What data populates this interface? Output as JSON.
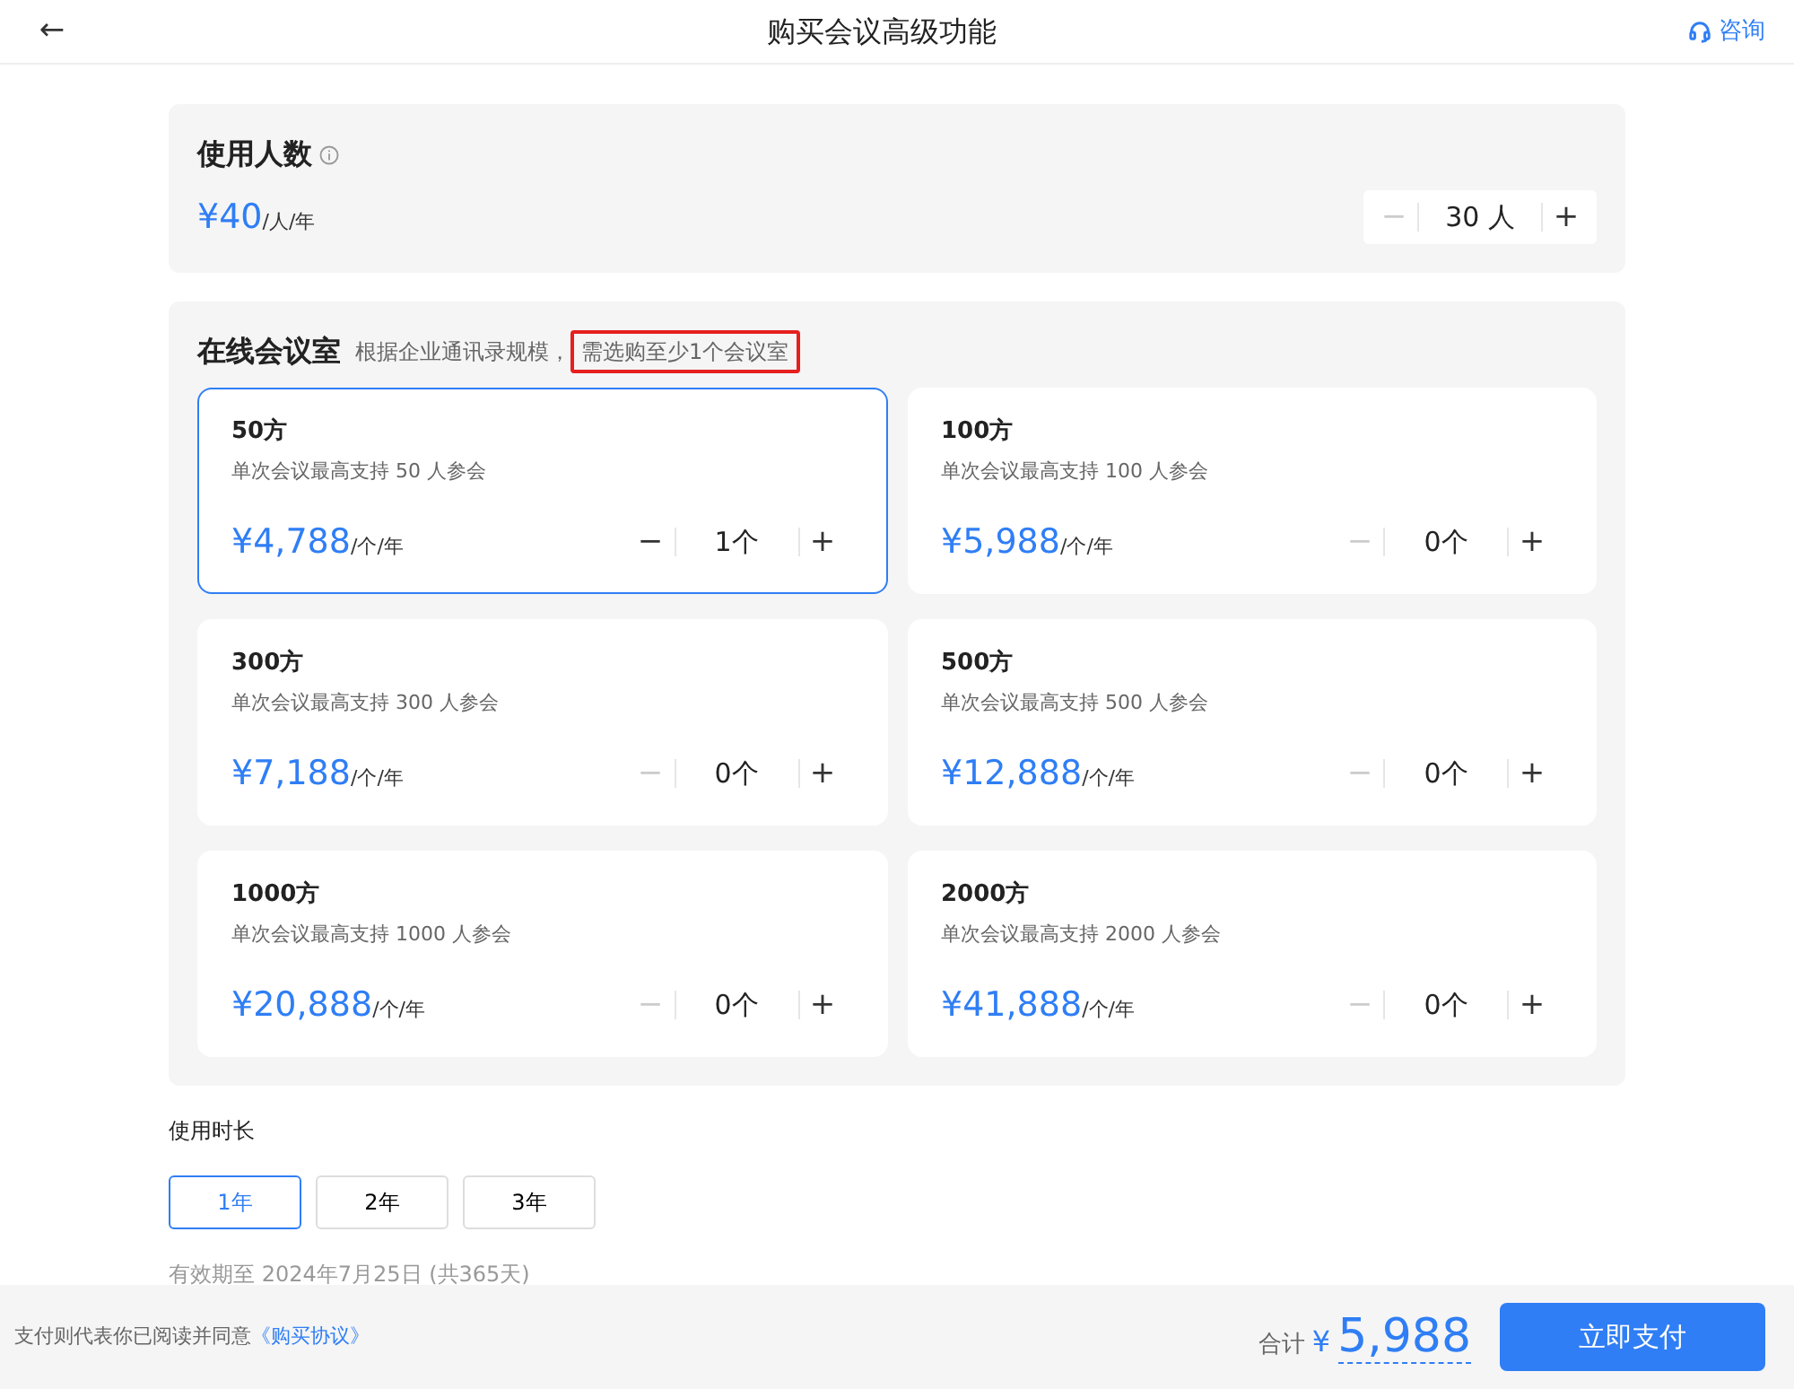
{
  "header": {
    "back": "←",
    "title": "购买会议高级功能",
    "help": "咨询"
  },
  "users": {
    "title": "使用人数",
    "price": "¥40",
    "unit": "/人/年",
    "stepper": {
      "minus": "−",
      "value": "30 人",
      "plus": "+",
      "minus_disabled": true
    }
  },
  "rooms": {
    "title": "在线会议室",
    "hint": "根据企业通讯录规模，",
    "note": {
      "text": "需选购至少1个会议室",
      "highlighted": true
    },
    "items": [
      {
        "name": "50方",
        "desc": "单次会议最高支持 50 人参会",
        "price": "¥4,788",
        "unit": "/个/年",
        "selected": true,
        "stepper": {
          "minus": "−",
          "value": "1个",
          "plus": "+",
          "minus_disabled": false
        }
      },
      {
        "name": "100方",
        "desc": "单次会议最高支持 100 人参会",
        "price": "¥5,988",
        "unit": "/个/年",
        "selected": false,
        "stepper": {
          "minus": "−",
          "value": "0个",
          "plus": "+",
          "minus_disabled": true
        }
      },
      {
        "name": "300方",
        "desc": "单次会议最高支持 300 人参会",
        "price": "¥7,188",
        "unit": "/个/年",
        "selected": false,
        "stepper": {
          "minus": "−",
          "value": "0个",
          "plus": "+",
          "minus_disabled": true
        }
      },
      {
        "name": "500方",
        "desc": "单次会议最高支持 500 人参会",
        "price": "¥12,888",
        "unit": "/个/年",
        "selected": false,
        "stepper": {
          "minus": "−",
          "value": "0个",
          "plus": "+",
          "minus_disabled": true
        }
      },
      {
        "name": "1000方",
        "desc": "单次会议最高支持 1000 人参会",
        "price": "¥20,888",
        "unit": "/个/年",
        "selected": false,
        "stepper": {
          "minus": "−",
          "value": "0个",
          "plus": "+",
          "minus_disabled": true
        }
      },
      {
        "name": "2000方",
        "desc": "单次会议最高支持 2000 人参会",
        "price": "¥41,888",
        "unit": "/个/年",
        "selected": false,
        "stepper": {
          "minus": "−",
          "value": "0个",
          "plus": "+",
          "minus_disabled": true
        }
      }
    ]
  },
  "duration": {
    "label": "使用时长",
    "options": [
      {
        "label": "1年",
        "selected": true
      },
      {
        "label": "2年",
        "selected": false
      },
      {
        "label": "3年",
        "selected": false
      }
    ],
    "validity": "有效期至 2024年7月25日 (共365天)"
  },
  "footer": {
    "agreement": "支付则代表你已阅读并同意",
    "agreement_link": "《购买协议》",
    "total_label": "合计",
    "currency": "¥",
    "total": "5,988",
    "pay_button": "立即支付"
  }
}
